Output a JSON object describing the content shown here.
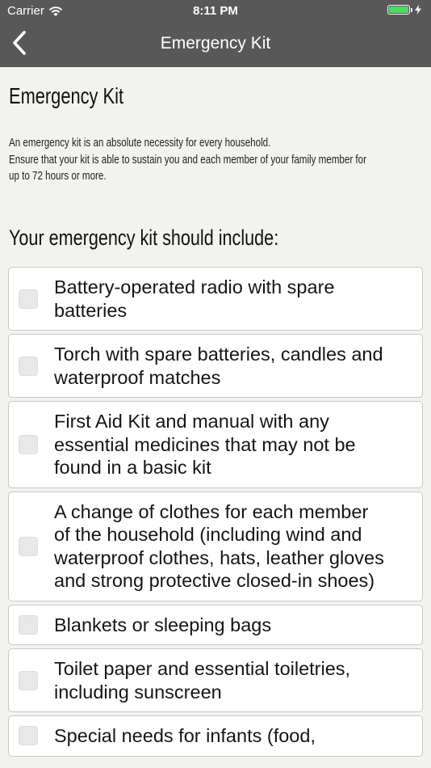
{
  "status_bar": {
    "carrier": "Carrier",
    "time": "8:11 PM",
    "battery_color": "#4cd964"
  },
  "nav": {
    "title": "Emergency Kit",
    "back_icon": "chevron-left-icon"
  },
  "page": {
    "heading": "Emergency Kit",
    "intro_lines": [
      "An emergency kit is an absolute necessity for every household.",
      "Ensure that your kit is able to sustain you and each member of your family member for",
      "up to 72 hours or more."
    ],
    "subheading": "Your emergency kit should include:"
  },
  "checklist": [
    {
      "lines": [
        "Battery-operated radio with spare",
        "batteries"
      ],
      "checked": false
    },
    {
      "lines": [
        "Torch with spare batteries, candles and",
        "waterproof matches"
      ],
      "checked": false
    },
    {
      "lines": [
        "First Aid Kit and manual with any",
        "essential medicines that may not be",
        "found in a basic kit"
      ],
      "checked": false
    },
    {
      "lines": [
        "A change of clothes for each member",
        "of the household (including wind and",
        "waterproof clothes, hats, leather gloves",
        "and strong protective closed-in shoes)"
      ],
      "checked": false
    },
    {
      "lines": [
        "Blankets or sleeping bags"
      ],
      "checked": false
    },
    {
      "lines": [
        "Toilet paper and essential toiletries,",
        "including sunscreen"
      ],
      "checked": false
    },
    {
      "lines": [
        "Special needs for infants (food,"
      ],
      "checked": false
    }
  ]
}
